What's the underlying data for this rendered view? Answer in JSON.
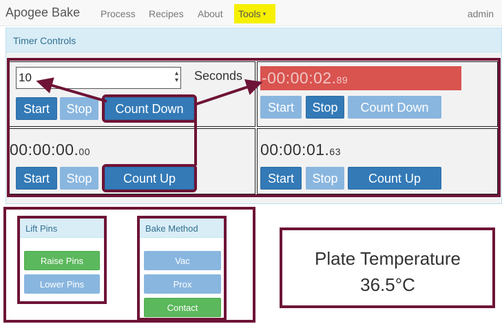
{
  "navbar": {
    "brand": "Apogee Bake",
    "links": [
      "Process",
      "Recipes",
      "About"
    ],
    "tools_label": "Tools",
    "user": "admin"
  },
  "timer_panel": {
    "heading": "Timer Controls",
    "input": {
      "value": "10",
      "unit_label": "Seconds"
    },
    "timers": [
      {
        "time_main": "",
        "time_ms": "",
        "buttons": [
          "Start",
          "Stop",
          "Count Down"
        ]
      },
      {
        "time_main": "-00:00:02.",
        "time_ms": "89",
        "buttons": [
          "Start",
          "Stop",
          "Count Down"
        ]
      },
      {
        "time_main": "00:00:00.",
        "time_ms": "00",
        "buttons": [
          "Start",
          "Stop",
          "Count Up"
        ]
      },
      {
        "time_main": "00:00:01.",
        "time_ms": "63",
        "buttons": [
          "Start",
          "Stop",
          "Count Up"
        ]
      }
    ]
  },
  "lift_pins": {
    "heading": "Lift Pins",
    "buttons": [
      "Raise Pins",
      "Lower Pins"
    ]
  },
  "bake_method": {
    "heading": "Bake Method",
    "buttons": [
      "Vac",
      "Prox",
      "Contact"
    ]
  },
  "plate_temperature": {
    "label": "Plate Temperature",
    "value": "36.5°C"
  },
  "colors": {
    "primary": "#337ab7",
    "primary_disabled": "#89b6df",
    "success": "#5cb85c",
    "danger": "#d9534f",
    "info_bg": "#d9edf7",
    "annotation": "#6e1436",
    "tools_highlight": "#f6f000"
  }
}
